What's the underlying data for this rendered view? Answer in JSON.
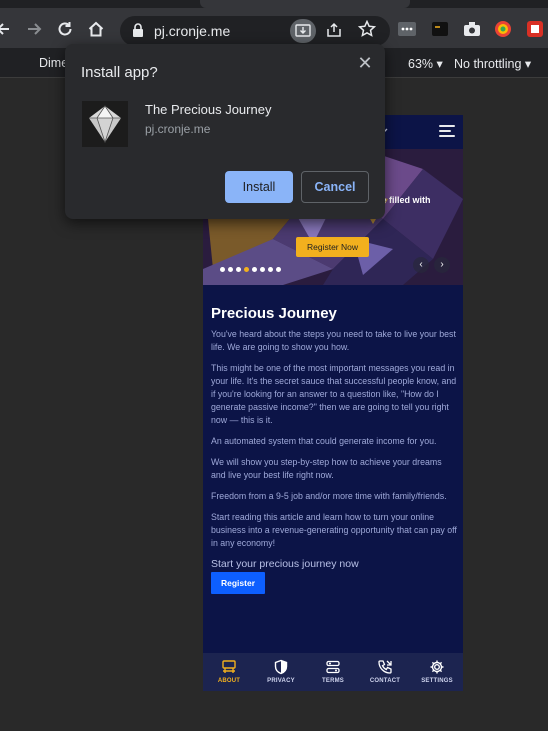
{
  "browser": {
    "url": "pj.cronje.me",
    "icons": {
      "back": "back-arrow-icon",
      "forward": "forward-arrow-icon",
      "reload": "reload-icon",
      "home": "home-icon",
      "lock": "lock-icon",
      "install": "install-app-icon",
      "share": "share-icon",
      "bookmark": "star-icon"
    }
  },
  "devtools": {
    "dimensions_label": "Dime",
    "zoom": "63%",
    "throttling": "No throttling"
  },
  "install_dialog": {
    "title": "Install app?",
    "app_name": "The Precious Journey",
    "app_url": "pj.cronje.me",
    "install_label": "Install",
    "cancel_label": "Cancel",
    "close_glyph": "✕"
  },
  "page": {
    "hero_text": "l be filled with",
    "hero_button": "Register Now",
    "carousel": {
      "count": 8,
      "active_index": 3
    },
    "heading": "Precious Journey",
    "paragraphs": [
      "You've heard about the steps you need to take to live your best life. We are going to show you how.",
      "This might be one of the most important messages you read in your life. It's the secret sauce that successful people know, and if you're looking for an answer to a question like, \"How do I generate passive income?\" then we are going to tell you right now — this is it.",
      "An automated system that could generate income for you.",
      "We will show you step-by-step how to achieve your dreams and live your best life right now.",
      "Freedom from a 9-5 job and/or more time with family/friends.",
      "Start reading this article and learn how to turn your online business into a revenue-generating opportunity that can pay off in any economy!"
    ],
    "cta_text": "Start your precious journey now",
    "register_label": "Register",
    "accent": "#f2b01e",
    "background": "#0c1447"
  },
  "bottom_nav": [
    {
      "label": "ABOUT",
      "icon": "about-icon"
    },
    {
      "label": "PRIVACY",
      "icon": "shield-icon"
    },
    {
      "label": "TERMS",
      "icon": "terms-icon"
    },
    {
      "label": "CONTACT",
      "icon": "phone-icon"
    },
    {
      "label": "SETTINGS",
      "icon": "gear-icon"
    }
  ]
}
